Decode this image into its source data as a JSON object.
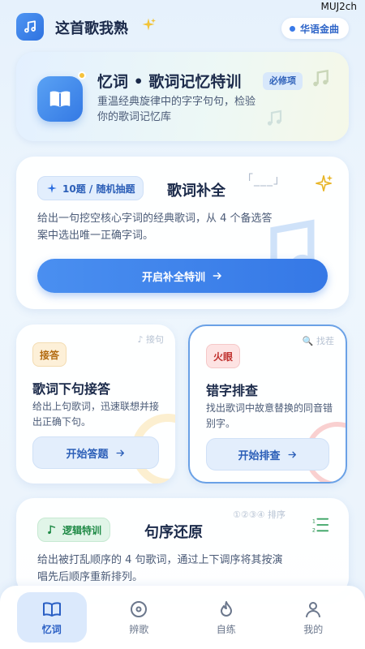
{
  "watermark": "MUJ2ch",
  "header": {
    "title": "这首歌我熟",
    "lang_label": "华语金曲"
  },
  "hero": {
    "title": "忆词 • 歌词记忆特训",
    "badge": "必修项",
    "desc": "重温经典旋律中的字字句句，检验你的歌词记忆库"
  },
  "complete_card": {
    "tag": "10题 / 随机抽题",
    "title": "歌词补全",
    "blank": "「___」",
    "desc": "给出一句挖空核心字词的经典歌词，从 4 个备选答案中选出唯一正确字词。",
    "button": "开启补全特训"
  },
  "answer_card": {
    "tag": "接答",
    "corner": "♪ 接句",
    "title": "歌词下句接答",
    "desc": "给出上句歌词，迅速联想并接出正确下句。",
    "button": "开始答题"
  },
  "typo_card": {
    "tag": "火眼",
    "corner": "🔍 找茬",
    "title": "错字排查",
    "desc": "找出歌词中故意替换的同音错别字。",
    "button": "开始排查"
  },
  "order_card": {
    "tag": "逻辑特训",
    "corner": "①②③④ 排序",
    "title": "句序还原",
    "desc": "给出被打乱顺序的 4 句歌词，通过上下调序将其按演唱先后顺序重新排列。"
  },
  "nav": [
    {
      "label": "忆词",
      "icon": "book-icon",
      "active": true
    },
    {
      "label": "辨歌",
      "icon": "disc-icon",
      "active": false
    },
    {
      "label": "自练",
      "icon": "flame-icon",
      "active": false
    },
    {
      "label": "我的",
      "icon": "user-icon",
      "active": false
    }
  ],
  "colors": {
    "accent": "#3578e6",
    "background": "#e6f1fc",
    "tag_orange": "#b26a10",
    "tag_red": "#c0312e",
    "tag_green": "#1f8a46"
  }
}
